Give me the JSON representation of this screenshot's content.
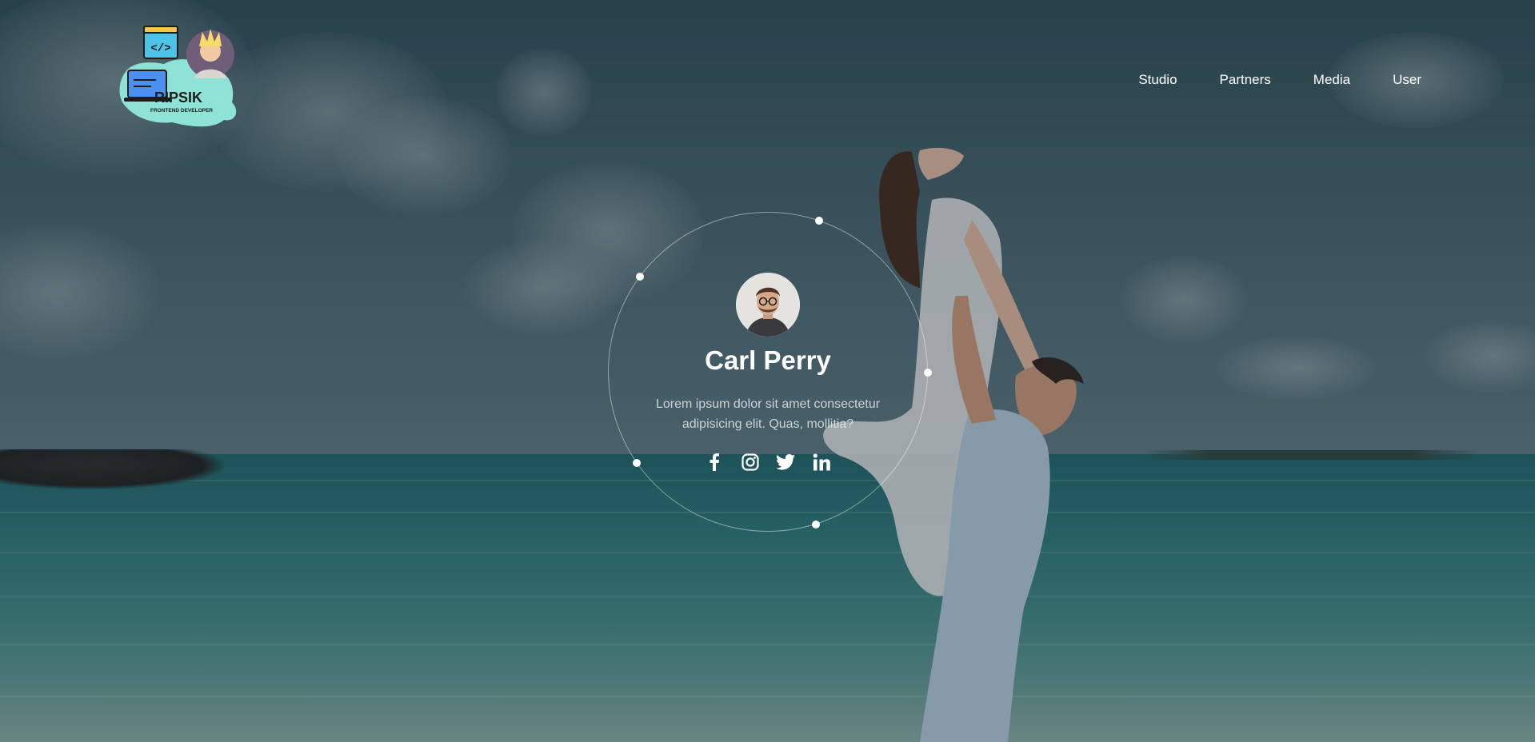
{
  "brand": {
    "name": "RIPSIK",
    "tagline": "FRONTEND DEVELOPER",
    "logo_icon": "code-icon"
  },
  "nav": {
    "items": [
      {
        "label": "Studio"
      },
      {
        "label": "Partners"
      },
      {
        "label": "Media"
      },
      {
        "label": "User"
      }
    ]
  },
  "profile": {
    "name": "Carl Perry",
    "bio": "Lorem ipsum dolor sit amet consectetur adipisicing elit. Quas, mollitia?",
    "socials": [
      {
        "icon": "facebook-icon"
      },
      {
        "icon": "instagram-icon"
      },
      {
        "icon": "twitter-icon"
      },
      {
        "icon": "linkedin-icon"
      }
    ]
  },
  "colors": {
    "text": "#ffffff",
    "logo_splash": "#8fe3d6",
    "overlay": "#2c4a55"
  }
}
